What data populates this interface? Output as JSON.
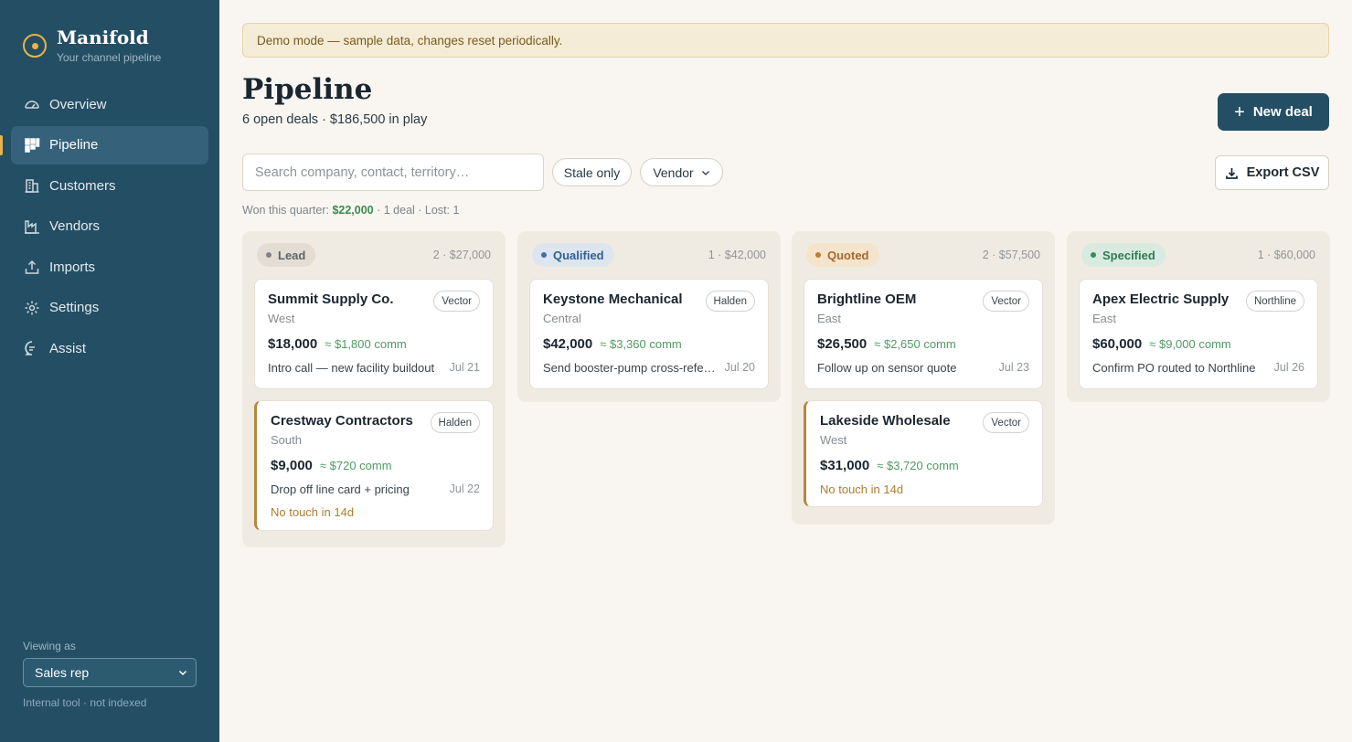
{
  "app": {
    "name": "Manifold",
    "tagline": "Your channel pipeline"
  },
  "sidebar": {
    "items": [
      {
        "label": "Overview",
        "icon": "gauge-icon"
      },
      {
        "label": "Pipeline",
        "icon": "kanban-icon",
        "active": true
      },
      {
        "label": "Customers",
        "icon": "building-icon"
      },
      {
        "label": "Vendors",
        "icon": "factory-icon"
      },
      {
        "label": "Imports",
        "icon": "upload-icon"
      },
      {
        "label": "Settings",
        "icon": "gear-icon"
      },
      {
        "label": "Assist",
        "icon": "chat-icon"
      }
    ],
    "viewing_label": "Viewing as",
    "role": "Sales rep",
    "footnote": "Internal tool · not indexed"
  },
  "banner": "Demo mode — sample data, changes reset periodically.",
  "header": {
    "title": "Pipeline",
    "subtitle": "6 open deals · $186,500 in play",
    "new_deal_label": "New deal"
  },
  "toolbar": {
    "search_placeholder": "Search company, contact, territory…",
    "stale_label": "Stale only",
    "vendor_label": "Vendor",
    "export_label": "Export CSV"
  },
  "summary": {
    "prefix": "Won this quarter:",
    "won": "$22,000",
    "suffix": "· 1 deal · Lost: 1"
  },
  "colors": {
    "sidebar": "#244e63",
    "accent": "#e8b34a",
    "commission": "#4f9a63",
    "stale": "#b07d2a"
  },
  "columns": [
    {
      "stage": "Lead",
      "count": "2 · $27,000",
      "cards": [
        {
          "company": "Summit Supply Co.",
          "vendor": "Vector",
          "region": "West",
          "amount": "$18,000",
          "comm": "≈ $1,800 comm",
          "note": "Intro call — new facility buildout",
          "date": "Jul 21"
        },
        {
          "company": "Crestway Contractors",
          "vendor": "Halden",
          "region": "South",
          "amount": "$9,000",
          "comm": "≈ $720 comm",
          "note": "Drop off line card + pricing",
          "date": "Jul 22",
          "stale": "No touch in 14d"
        }
      ]
    },
    {
      "stage": "Qualified",
      "count": "1 · $42,000",
      "cards": [
        {
          "company": "Keystone Mechanical",
          "vendor": "Halden",
          "region": "Central",
          "amount": "$42,000",
          "comm": "≈ $3,360 comm",
          "note": "Send booster-pump cross-refer…",
          "date": "Jul 20"
        }
      ]
    },
    {
      "stage": "Quoted",
      "count": "2 · $57,500",
      "cards": [
        {
          "company": "Brightline OEM",
          "vendor": "Vector",
          "region": "East",
          "amount": "$26,500",
          "comm": "≈ $2,650 comm",
          "note": "Follow up on sensor quote",
          "date": "Jul 23"
        },
        {
          "company": "Lakeside Wholesale",
          "vendor": "Vector",
          "region": "West",
          "amount": "$31,000",
          "comm": "≈ $3,720 comm",
          "stale": "No touch in 14d"
        }
      ]
    },
    {
      "stage": "Specified",
      "count": "1 · $60,000",
      "cards": [
        {
          "company": "Apex Electric Supply",
          "vendor": "Northline",
          "region": "East",
          "amount": "$60,000",
          "comm": "≈ $9,000 comm",
          "note": "Confirm PO routed to Northline",
          "date": "Jul 26"
        }
      ]
    }
  ]
}
